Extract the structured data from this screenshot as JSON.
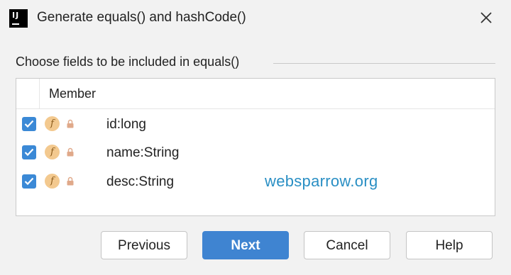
{
  "window": {
    "title": "Generate equals() and hashCode()",
    "app_icon_text": "IJ"
  },
  "group": {
    "label": "Choose fields to be included in equals()"
  },
  "table": {
    "header": "Member",
    "rows": [
      {
        "label": "id:long",
        "checked": true,
        "icon": "field-icon",
        "visibility": "private"
      },
      {
        "label": "name:String",
        "checked": true,
        "icon": "field-icon",
        "visibility": "private"
      },
      {
        "label": "desc:String",
        "checked": true,
        "icon": "field-icon",
        "visibility": "private"
      }
    ],
    "field_icon_letter": "f"
  },
  "watermark": "websparrow.org",
  "buttons": {
    "previous": "Previous",
    "next": "Next",
    "cancel": "Cancel",
    "help": "Help"
  },
  "colors": {
    "accent": "#3f84d1",
    "checkbox": "#3b89d6",
    "field_icon": "#f3c98f",
    "lock": "#e0a98a",
    "watermark": "#2a8fc4"
  }
}
